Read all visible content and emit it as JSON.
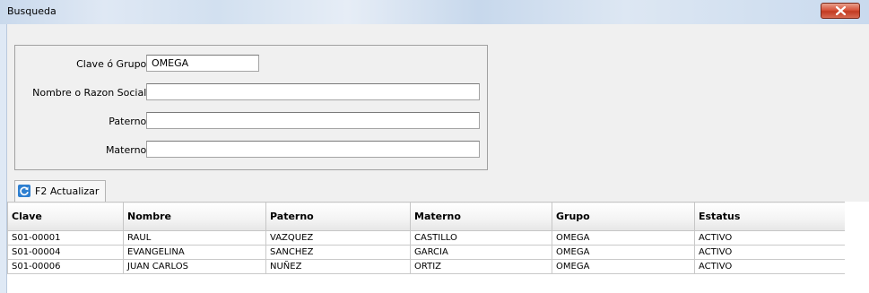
{
  "window": {
    "title": "Busqueda"
  },
  "form": {
    "clave": {
      "label": "Clave ó Grupo:",
      "value": "OMEGA"
    },
    "nombre": {
      "label": "Nombre o Razon Social:",
      "value": ""
    },
    "paterno": {
      "label": "Paterno:",
      "value": ""
    },
    "materno": {
      "label": "Materno:",
      "value": ""
    }
  },
  "toolbar": {
    "refresh_label": "F2 Actualizar",
    "refresh_icon": "refresh-icon"
  },
  "table": {
    "columns": [
      "Clave",
      "Nombre",
      "Paterno",
      "Materno",
      "Grupo",
      "Estatus"
    ],
    "rows": [
      [
        "S01-00001",
        "RAUL",
        "VAZQUEZ",
        "CASTILLO",
        "OMEGA",
        "ACTIVO"
      ],
      [
        "S01-00004",
        "EVANGELINA",
        "SANCHEZ",
        "GARCIA",
        "OMEGA",
        "ACTIVO"
      ],
      [
        "S01-00006",
        "JUAN CARLOS",
        "NUÑEZ",
        "ORTIZ",
        "OMEGA",
        "ACTIVO"
      ]
    ]
  },
  "colors": {
    "close_button": "#c94a30",
    "refresh_icon": "#2e7fd0"
  }
}
